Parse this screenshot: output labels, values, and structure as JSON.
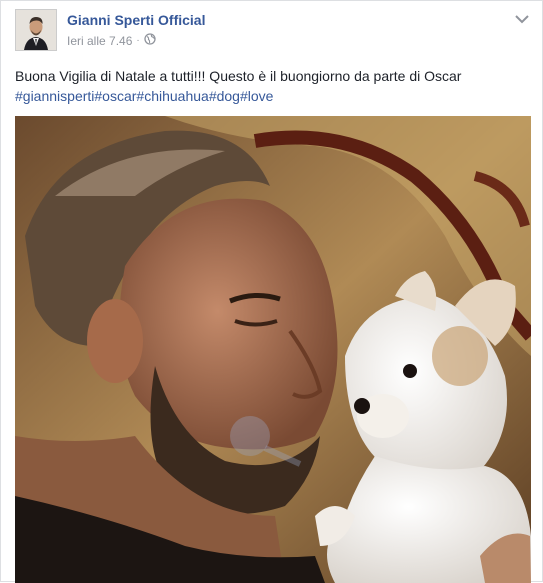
{
  "post": {
    "author": "Gianni Sperti Official",
    "timestamp": "Ieri alle 7.46",
    "privacy_icon": "globe-icon",
    "menu_icon": "chevron-down-icon",
    "text": "Buona Vigilia di Natale a tutti!!! Questo è il buongiorno da parte di Oscar",
    "hashtags": [
      "#giannisperti",
      "#oscar",
      "#chihuahua",
      "#dog",
      "#love"
    ]
  },
  "colors": {
    "link": "#365899",
    "meta": "#90949c",
    "text": "#1d2129"
  }
}
